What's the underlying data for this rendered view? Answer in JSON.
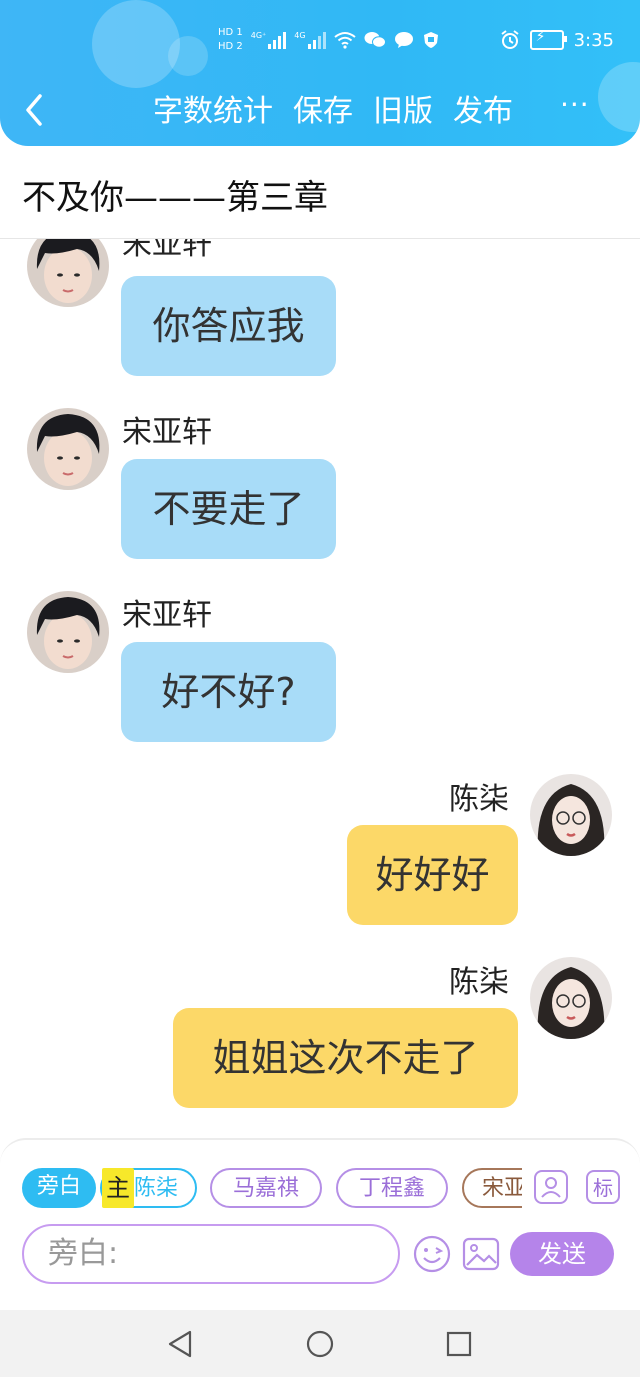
{
  "status_bar": {
    "hd1": "HD 1",
    "hd2": "HD 2",
    "net1": "4G⁺",
    "net2": "4G",
    "time": "3:35"
  },
  "nav": {
    "actions": [
      "字数统计",
      "保存",
      "旧版",
      "发布"
    ],
    "more": "···"
  },
  "doc": {
    "title": "不及你———第三章"
  },
  "messages": [
    {
      "side": "left",
      "speaker": "宋亚轩",
      "text": "你答应我"
    },
    {
      "side": "left",
      "speaker": "宋亚轩",
      "text": "不要走了"
    },
    {
      "side": "left",
      "speaker": "宋亚轩",
      "text": "好不好?"
    },
    {
      "side": "right",
      "speaker": "陈柒",
      "text": "好好好"
    },
    {
      "side": "right",
      "speaker": "陈柒",
      "text": "姐姐这次不走了"
    }
  ],
  "composer": {
    "roles": {
      "narration": "旁白",
      "main_tag": "主",
      "chen": "陈柒",
      "ma": "马嘉祺",
      "ding": "丁程鑫",
      "song": "宋亚"
    },
    "tag_button": "标",
    "input_placeholder": "旁白:",
    "send": "发送"
  },
  "colors": {
    "header": "#30b8f5",
    "left_bubble": "#a8dcf8",
    "right_bubble": "#fcd868",
    "accent_purple": "#b584ea"
  }
}
